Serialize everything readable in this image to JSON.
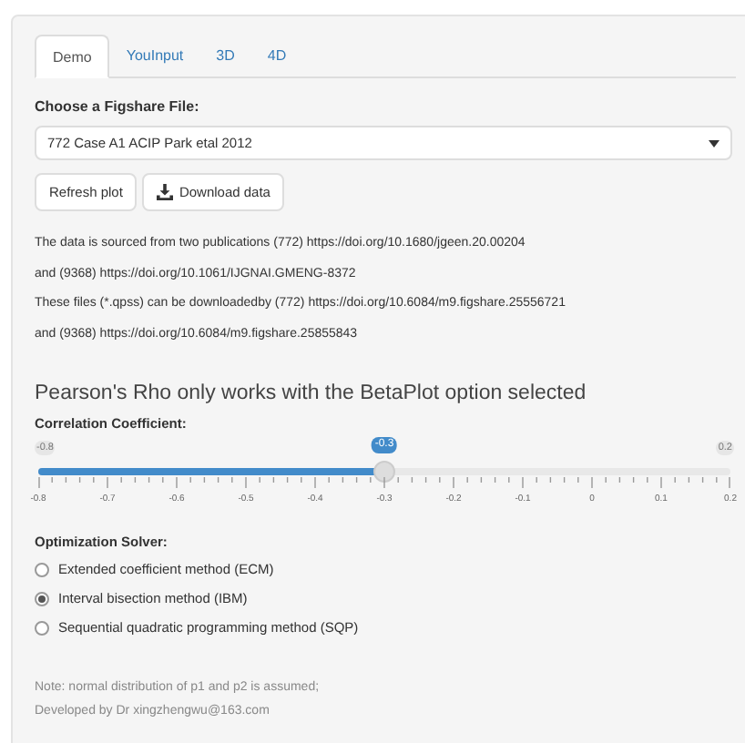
{
  "tabs": [
    {
      "label": "Demo",
      "selected": true
    },
    {
      "label": "YouInput",
      "selected": false
    },
    {
      "label": "3D",
      "selected": false
    },
    {
      "label": "4D",
      "selected": false
    }
  ],
  "file_select": {
    "label": "Choose a Figshare File:",
    "value": "772 Case A1 ACIP Park etal 2012"
  },
  "buttons": [
    {
      "label": "Refresh plot",
      "kind": "plain"
    },
    {
      "label": "Download data",
      "kind": "download"
    }
  ],
  "info_lines": [
    "The data is sourced from two publications (772) https://doi.org/10.1680/jgeen.20.00204",
    "and (9368) https://doi.org/10.1061/IJGNAI.GMENG-8372",
    "These files (*.qpss) can be downloadedby (772) https://doi.org/10.6084/m9.figshare.25556721",
    "and (9368) https://doi.org/10.6084/m9.figshare.25855843"
  ],
  "heading": "Pearson's Rho only works with the BetaPlot option selected",
  "slider": {
    "label": "Correlation Coefficient:",
    "min": "-0.8",
    "max": "0.2",
    "value": "-0.3",
    "level": 0.5,
    "ticks": [
      "-0.8",
      "-0.7",
      "-0.6",
      "-0.5",
      "-0.4",
      "-0.3",
      "-0.2",
      "-0.1",
      "0",
      "0.1",
      "0.2"
    ]
  },
  "solver": {
    "label": "Optimization Solver:",
    "options": [
      {
        "label": "Extended coefficient method (ECM)",
        "selected": false
      },
      {
        "label": "Interval bisection method (IBM)",
        "selected": true
      },
      {
        "label": "Sequential quadratic programming method (SQP)",
        "selected": false
      }
    ]
  },
  "notes": [
    "Note: normal distribution of p1 and p2 is assumed;",
    "Developed by Dr xingzhengwu@163.com"
  ]
}
